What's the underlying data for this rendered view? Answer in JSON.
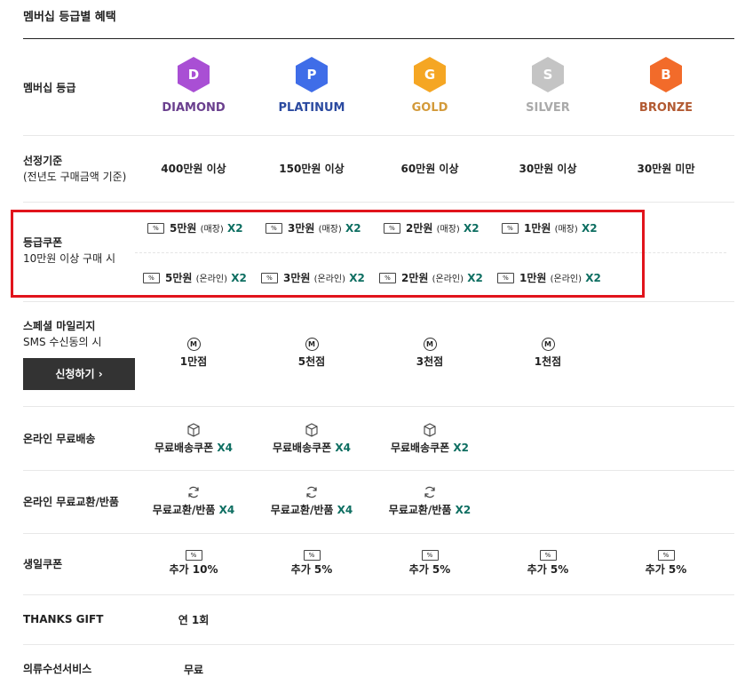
{
  "page_title": "멤버십 등급별 혜택",
  "grades": {
    "label": "멤버십 등급",
    "items": [
      {
        "letter": "D",
        "name": "DIAMOND",
        "color": "#a94fd4",
        "text_color": "#6a3f8e"
      },
      {
        "letter": "P",
        "name": "PLATINUM",
        "color": "#3f6de8",
        "text_color": "#2b4aa0"
      },
      {
        "letter": "G",
        "name": "GOLD",
        "color": "#f5a623",
        "text_color": "#d39a3a"
      },
      {
        "letter": "S",
        "name": "SILVER",
        "color": "#c4c4c4",
        "text_color": "#aaaaaa"
      },
      {
        "letter": "B",
        "name": "BRONZE",
        "color": "#f26b2a",
        "text_color": "#b25a32"
      }
    ]
  },
  "criteria": {
    "label": "선정기준",
    "sublabel": "(전년도 구매금액 기준)",
    "values": [
      "400만원 이상",
      "150만원 이상",
      "60만원 이상",
      "30만원 이상",
      "30만원 미만"
    ]
  },
  "coupon": {
    "label": "등급쿠폰",
    "sublabel": "10만원 이상 구매 시",
    "icon_text": "%",
    "store": [
      {
        "amount": "5만원",
        "type": "(매장)",
        "mult": "X2"
      },
      {
        "amount": "3만원",
        "type": "(매장)",
        "mult": "X2"
      },
      {
        "amount": "2만원",
        "type": "(매장)",
        "mult": "X2"
      },
      {
        "amount": "1만원",
        "type": "(매장)",
        "mult": "X2"
      }
    ],
    "online": [
      {
        "amount": "5만원",
        "type": "(온라인)",
        "mult": "X2"
      },
      {
        "amount": "3만원",
        "type": "(온라인)",
        "mult": "X2"
      },
      {
        "amount": "2만원",
        "type": "(온라인)",
        "mult": "X2"
      },
      {
        "amount": "1만원",
        "type": "(온라인)",
        "mult": "X2"
      }
    ]
  },
  "mileage": {
    "label": "스페셜 마일리지",
    "sublabel": "SMS 수신동의 시",
    "button": "신청하기",
    "button_arrow": "›",
    "icon_text": "M",
    "values": [
      "1만점",
      "5천점",
      "3천점",
      "1천점"
    ]
  },
  "shipping": {
    "label": "온라인 무료배송",
    "items": [
      {
        "text": "무료배송쿠폰",
        "mult": "X4"
      },
      {
        "text": "무료배송쿠폰",
        "mult": "X4"
      },
      {
        "text": "무료배송쿠폰",
        "mult": "X2"
      }
    ]
  },
  "exchange": {
    "label": "온라인 무료교환/반품",
    "items": [
      {
        "text": "무료교환/반품",
        "mult": "X4"
      },
      {
        "text": "무료교환/반품",
        "mult": "X4"
      },
      {
        "text": "무료교환/반품",
        "mult": "X2"
      }
    ]
  },
  "birthday": {
    "label": "생일쿠폰",
    "icon_text": "%",
    "values": [
      "추가 10%",
      "추가 5%",
      "추가 5%",
      "추가 5%",
      "추가 5%"
    ]
  },
  "thanks": {
    "label": "THANKS GIFT",
    "value": "연 1회"
  },
  "repair": {
    "label": "의류수선서비스",
    "value": "무료"
  }
}
